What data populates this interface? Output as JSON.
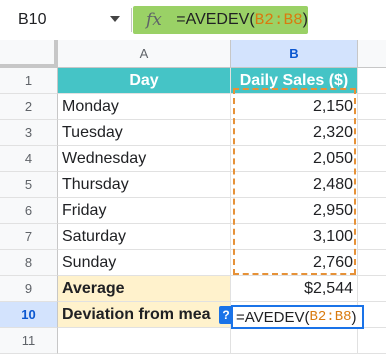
{
  "name_box": {
    "ref": "B10"
  },
  "formula_bar": {
    "fx": "fx",
    "prefix": "=AVEDEV(",
    "range": "B2:B8",
    "suffix": ")"
  },
  "columns": [
    "A",
    "B"
  ],
  "rows": [
    {
      "num": "1",
      "a": "Day",
      "b": "Daily Sales ($)"
    },
    {
      "num": "2",
      "a": "Monday",
      "b": "2,150"
    },
    {
      "num": "3",
      "a": "Tuesday",
      "b": "2,320"
    },
    {
      "num": "4",
      "a": "Wednesday",
      "b": "2,050"
    },
    {
      "num": "5",
      "a": "Thursday",
      "b": "2,480"
    },
    {
      "num": "6",
      "a": "Friday",
      "b": "2,950"
    },
    {
      "num": "7",
      "a": "Saturday",
      "b": "3,100"
    },
    {
      "num": "8",
      "a": "Sunday",
      "b": "2,760"
    },
    {
      "num": "9",
      "a": "Average",
      "b": "$2,544"
    },
    {
      "num": "10",
      "a": "Deviation from mea",
      "b": ""
    },
    {
      "num": "11",
      "a": "",
      "b": ""
    }
  ],
  "editor": {
    "help": "?",
    "prefix": "=AVEDEV(",
    "range": "B2:B8",
    "suffix": ")"
  },
  "colors": {
    "header_fill": "#45c4c6",
    "average_fill": "#fff2cc",
    "range_border": "#e69138",
    "formula_bg": "#9ad166"
  }
}
